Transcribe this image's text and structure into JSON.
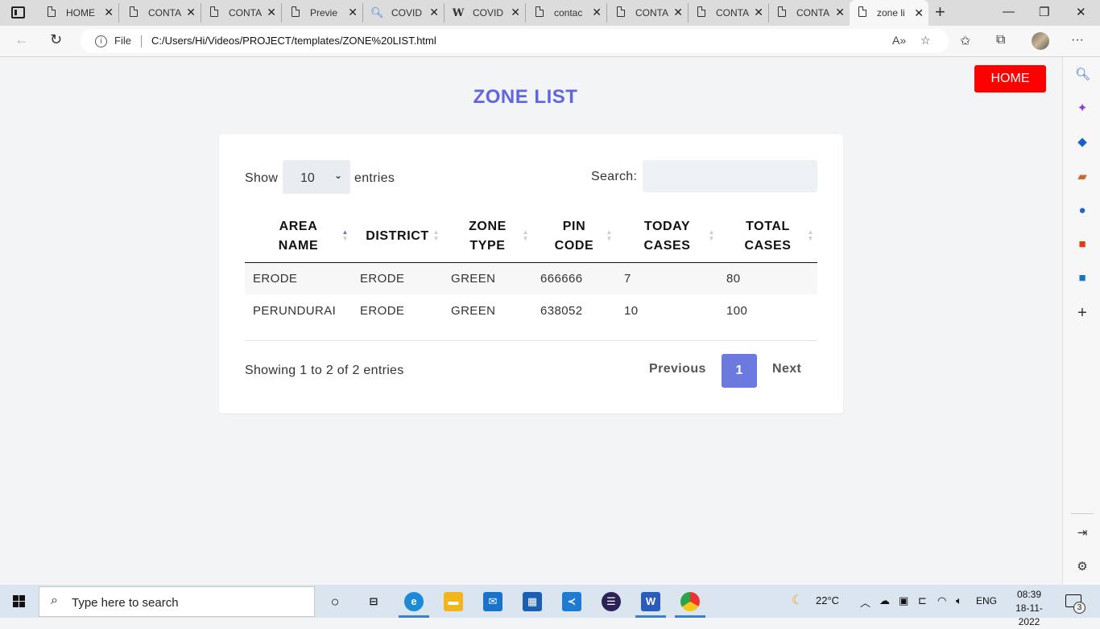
{
  "browser": {
    "tabs": [
      {
        "label": "HOME",
        "icon": "page-icon"
      },
      {
        "label": "CONTA",
        "icon": "page-icon"
      },
      {
        "label": "CONTA",
        "icon": "page-icon"
      },
      {
        "label": "Previe",
        "icon": "preview-icon"
      },
      {
        "label": "COVID",
        "icon": "search-icon"
      },
      {
        "label": "COVID",
        "icon": "wikipedia-icon"
      },
      {
        "label": "contac",
        "icon": "page-icon"
      },
      {
        "label": "CONTA",
        "icon": "page-icon"
      },
      {
        "label": "CONTA",
        "icon": "page-icon"
      },
      {
        "label": "CONTA",
        "icon": "page-icon"
      },
      {
        "label": "zone li",
        "icon": "page-icon",
        "active": true
      }
    ],
    "address": {
      "scheme_label": "File",
      "url": "C:/Users/Hi/Videos/PROJECT/templates/ZONE%20LIST.html"
    }
  },
  "page": {
    "home_button": "HOME",
    "title": "ZONE LIST",
    "length_menu": {
      "show_label": "Show",
      "selected": "10",
      "entries_label": "entries"
    },
    "search": {
      "label": "Search:",
      "value": ""
    },
    "table": {
      "columns": [
        {
          "line1": "AREA",
          "line2": "NAME",
          "sorted": "asc"
        },
        {
          "line1": "DISTRICT",
          "line2": "",
          "sorted": "none"
        },
        {
          "line1": "ZONE",
          "line2": "TYPE",
          "sorted": "none"
        },
        {
          "line1": "PIN",
          "line2": "CODE",
          "sorted": "none"
        },
        {
          "line1": "TODAY",
          "line2": "CASES",
          "sorted": "none"
        },
        {
          "line1": "TOTAL",
          "line2": "CASES",
          "sorted": "none"
        }
      ],
      "rows": [
        [
          "ERODE",
          "ERODE",
          "GREEN",
          "666666",
          "7",
          "80"
        ],
        [
          "PERUNDURAI",
          "ERODE",
          "GREEN",
          "638052",
          "10",
          "100"
        ]
      ]
    },
    "info": "Showing 1 to 2 of 2 entries",
    "pagination": {
      "previous": "Previous",
      "current": "1",
      "next": "Next"
    },
    "accent_color": "#6065e0",
    "home_color": "#ff0000"
  },
  "taskbar": {
    "search_placeholder": "Type here to search",
    "weather": "22°C",
    "language": "ENG",
    "time": "08:39",
    "date": "18-11-2022",
    "notifications": "3"
  }
}
